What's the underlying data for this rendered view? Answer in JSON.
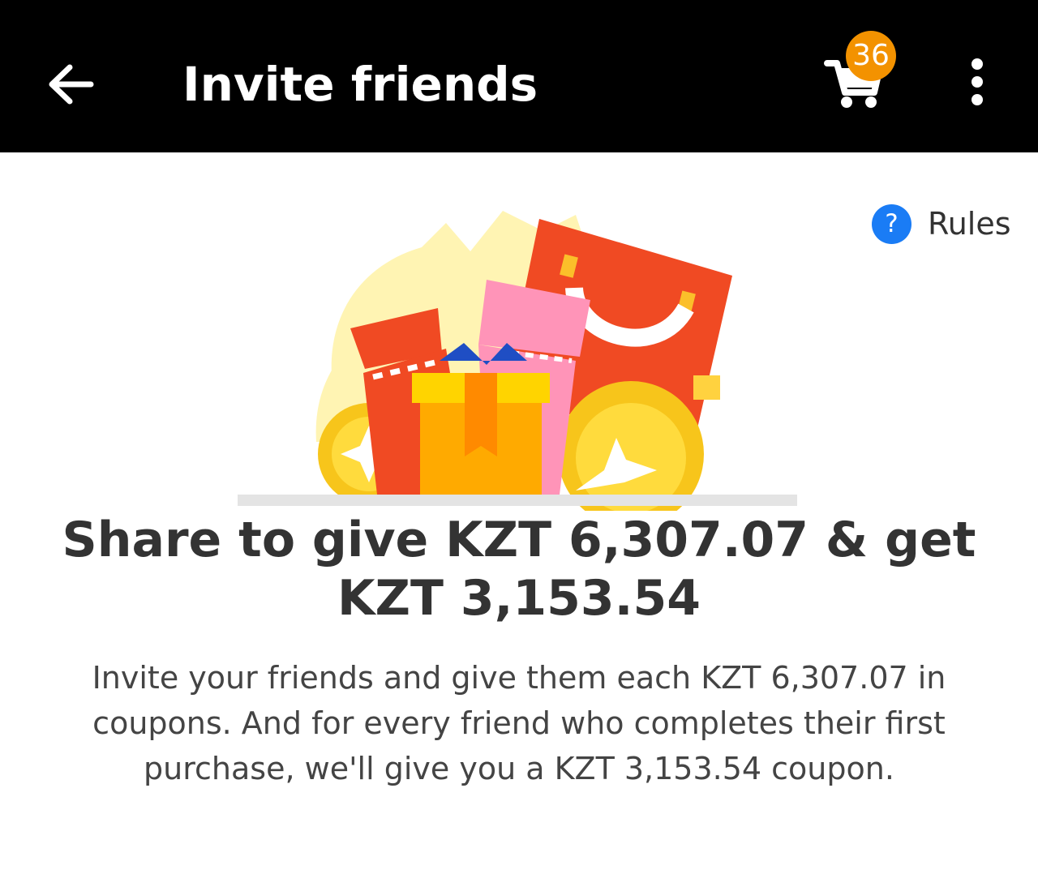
{
  "header": {
    "title": "Invite friends",
    "cart_count": "36"
  },
  "rules": {
    "icon_glyph": "?",
    "label": "Rules"
  },
  "promo": {
    "headline": "Share to give KZT 6,307.07 & get KZT 3,153.54",
    "description": "Invite your friends and give them each KZT 6,307.07 in coupons. And for every friend who completes their first purchase, we'll give you a KZT 3,153.54 coupon."
  },
  "icons": {
    "back": "arrow-left-icon",
    "cart": "shopping-cart-icon",
    "more": "more-vertical-icon",
    "rules": "question-circle-icon",
    "illustration": "gift-bag-illustration"
  },
  "colors": {
    "app_bar": "#000000",
    "badge": "#f39200",
    "rules_icon": "#1a7cf5",
    "text": "#333333"
  }
}
